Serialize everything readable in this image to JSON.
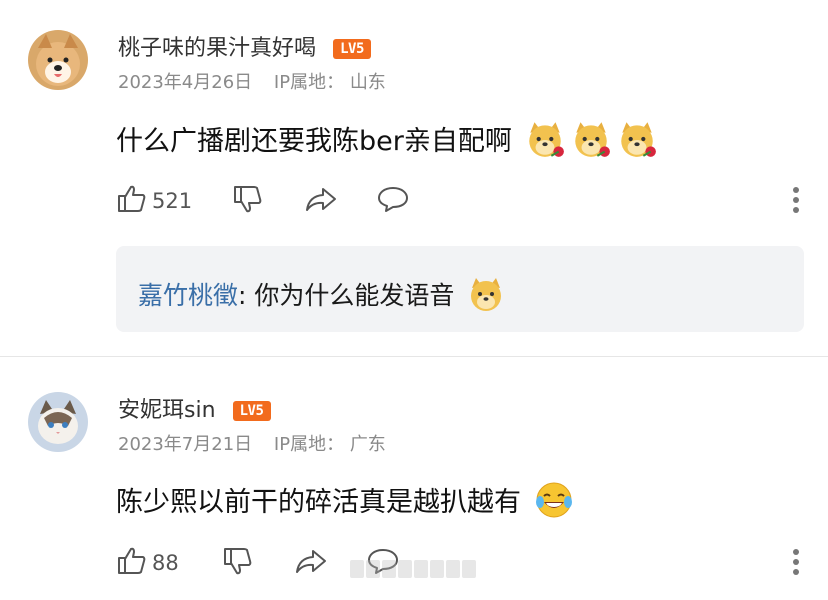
{
  "comments": [
    {
      "username": "桃子味的果汁真好喝",
      "level": "LV5",
      "date": "2023年4月26日",
      "ip_label": "IP属地：",
      "ip_location": "山东",
      "content": "什么广播剧还要我陈ber亲自配啊",
      "likes": "521",
      "reply": {
        "user": "嘉竹桃徵",
        "text": ": 你为什么能发语音"
      }
    },
    {
      "username": "安妮珥sin",
      "level": "LV5",
      "date": "2023年7月21日",
      "ip_label": "IP属地：",
      "ip_location": "广东",
      "content": "陈少熙以前干的碎活真是越扒越有",
      "likes": "88"
    }
  ],
  "colors": {
    "badge": "#f26b1d",
    "reply_user": "#3a6fa8",
    "meta": "#8a8a8a"
  }
}
